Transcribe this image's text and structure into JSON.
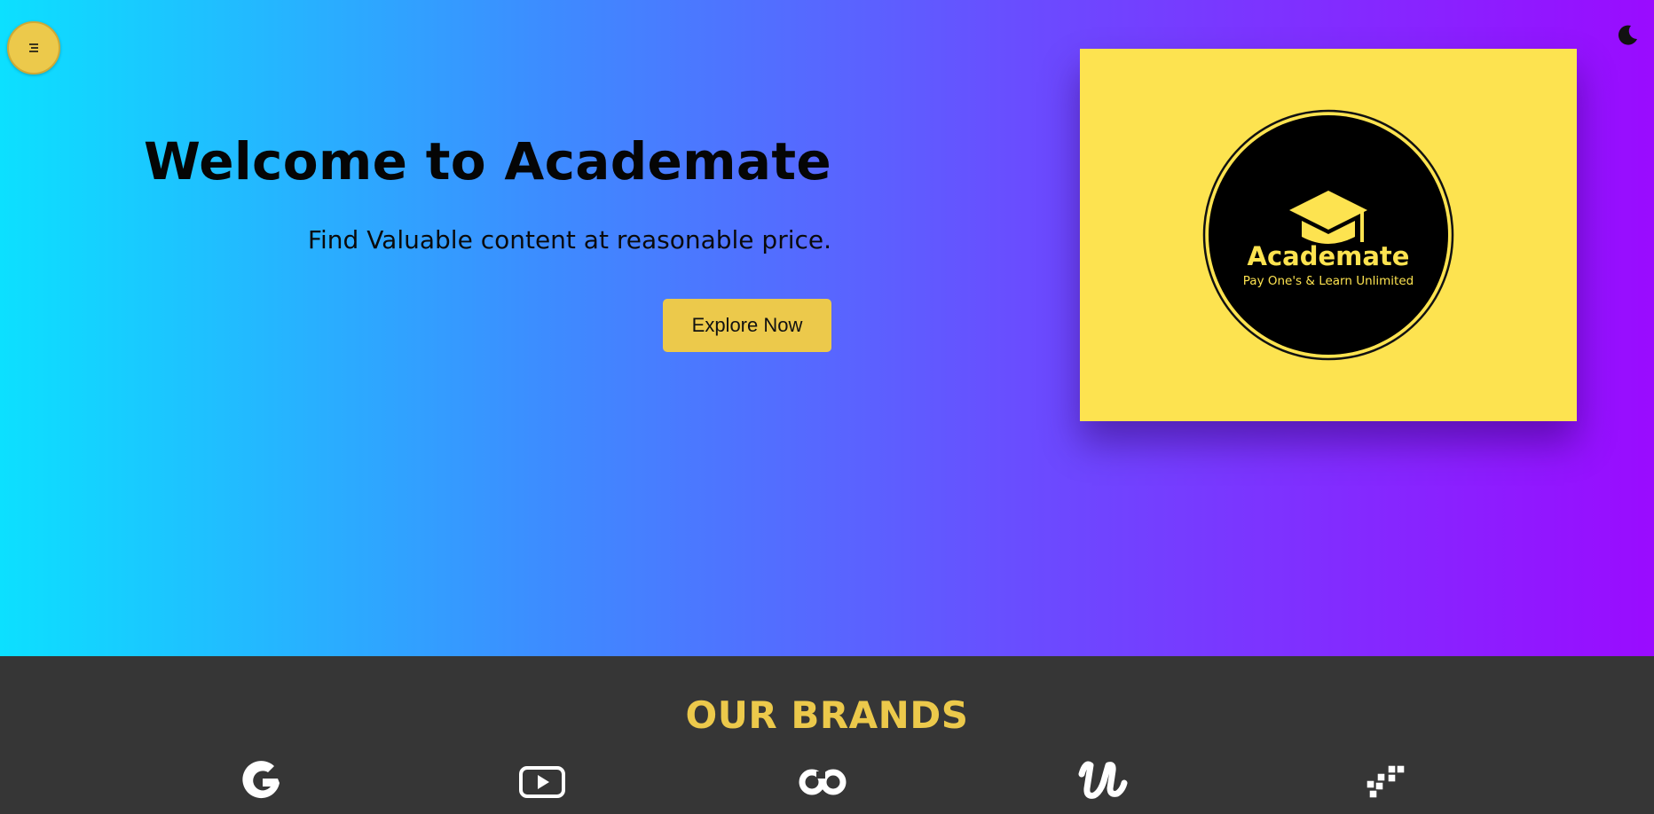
{
  "header": {
    "menu_icon": "hamburger-icon",
    "theme_icon": "moon-icon"
  },
  "hero": {
    "title": "Welcome to Academate",
    "subtitle": "Find Valuable content at reasonable price.",
    "cta_label": "Explore Now"
  },
  "logo": {
    "name": "Academate",
    "tagline": "Pay One's & Learn Unlimited",
    "icon": "graduation-cap-icon"
  },
  "brands": {
    "title": "OUR BRANDS",
    "items": [
      {
        "icon": "google-icon"
      },
      {
        "icon": "youtube-icon"
      },
      {
        "icon": "coursera-icon"
      },
      {
        "icon": "udemy-icon"
      },
      {
        "icon": "edx-cubes-icon"
      }
    ]
  },
  "colors": {
    "accent": "#ecc94b",
    "logo_bg": "#fde350",
    "footer_bg": "#363636",
    "gradient_start": "#0ce0ff",
    "gradient_end": "#9a0bff"
  }
}
